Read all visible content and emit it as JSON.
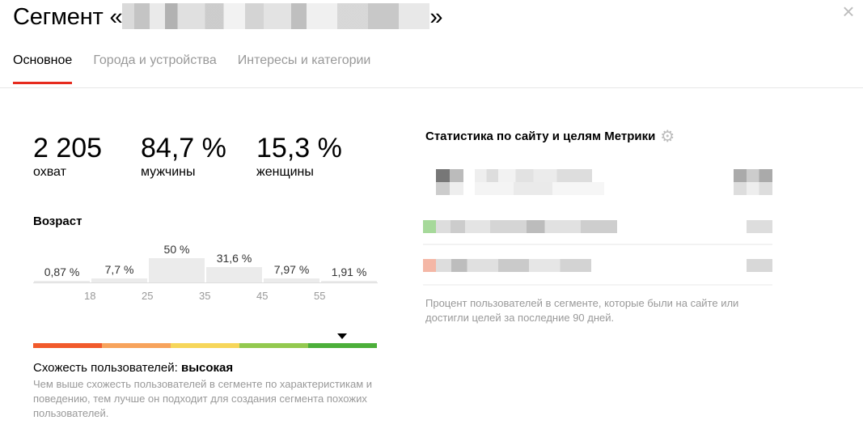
{
  "header": {
    "title_prefix": "Сегмент «",
    "title_suffix": "»",
    "close_icon": "close-icon"
  },
  "tabs": [
    {
      "label": "Основное",
      "active": true
    },
    {
      "label": "Города и устройства",
      "active": false
    },
    {
      "label": "Интересы и категории",
      "active": false
    }
  ],
  "stats": [
    {
      "value": "2 205",
      "label": "охват"
    },
    {
      "value": "84,7 %",
      "label": "мужчины"
    },
    {
      "value": "15,3 %",
      "label": "женщины"
    }
  ],
  "age": {
    "title": "Возраст",
    "bars": [
      {
        "label": "0,87 %",
        "value": 0.87
      },
      {
        "label": "7,7 %",
        "value": 7.7
      },
      {
        "label": "50 %",
        "value": 50
      },
      {
        "label": "31,6 %",
        "value": 31.6
      },
      {
        "label": "7,97 %",
        "value": 7.97
      },
      {
        "label": "1,91 %",
        "value": 1.91
      }
    ],
    "ticks": [
      "18",
      "25",
      "35",
      "45",
      "55"
    ]
  },
  "similarity": {
    "label": "Схожесть пользователей:",
    "value": "высокая",
    "level": 0.9,
    "colors": [
      "#f15a2b",
      "#f7a35c",
      "#f6d65a",
      "#93c94f",
      "#4caf3a"
    ],
    "description": "Чем выше схожесть пользователей в сегменте по характеристикам и поведению, тем лучше он подходит для создания сегмента похожих пользователей."
  },
  "metrika": {
    "title": "Статистика по сайту и целям Метрики",
    "gear_icon": "gear-icon",
    "footnote": "Процент пользователей в сегменте, которые были на сайте или достигли целей за последние 90 дней.",
    "row_colors": [
      "#a6d99a",
      "#f4b7a6"
    ]
  }
}
